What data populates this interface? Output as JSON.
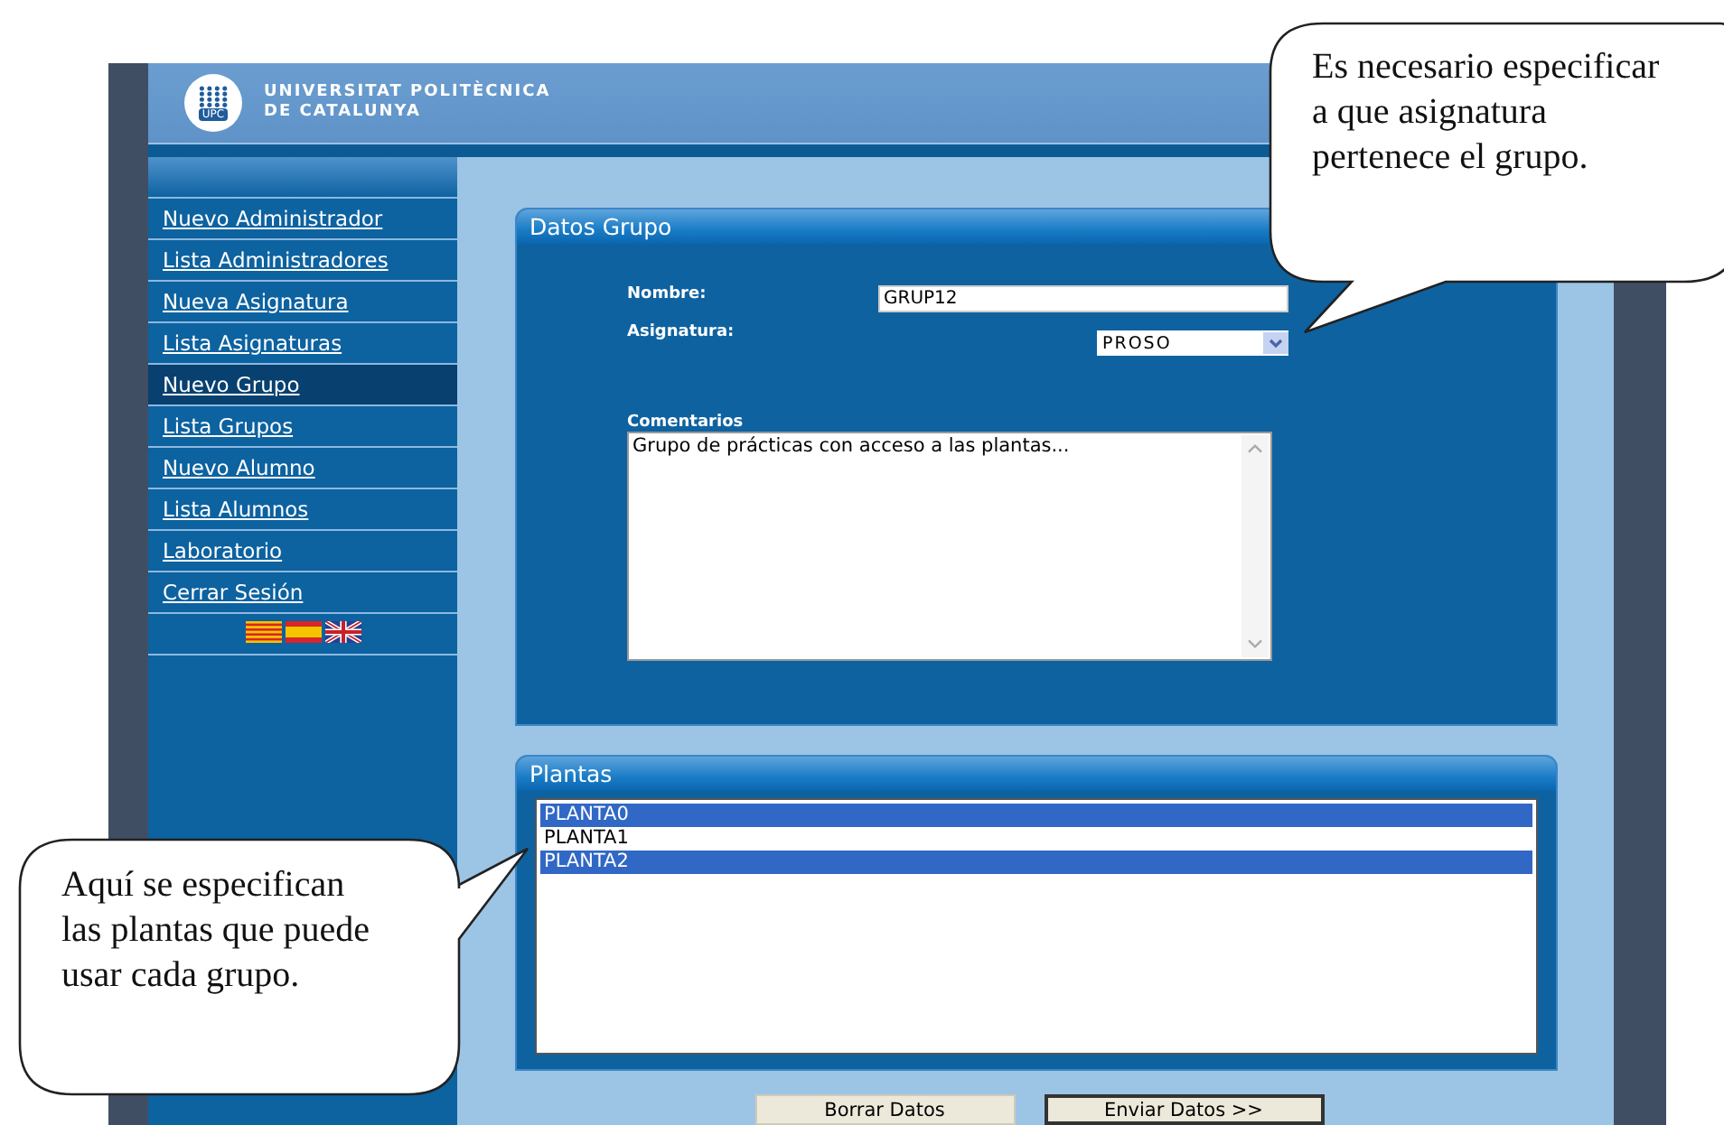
{
  "header": {
    "logo_badge": "UPC",
    "logo_lines": [
      "UNIVERSITAT POLITÈCNICA",
      "DE CATALUNYA"
    ]
  },
  "sidebar": {
    "items": [
      {
        "label": "Nuevo Administrador",
        "selected": false
      },
      {
        "label": "Lista Administradores",
        "selected": false
      },
      {
        "label": "Nueva Asignatura",
        "selected": false
      },
      {
        "label": "Lista Asignaturas",
        "selected": false
      },
      {
        "label": "Nuevo Grupo",
        "selected": true
      },
      {
        "label": "Lista Grupos",
        "selected": false
      },
      {
        "label": "Nuevo Alumno",
        "selected": false
      },
      {
        "label": "Lista Alumnos",
        "selected": false
      },
      {
        "label": "Laboratorio",
        "selected": false
      },
      {
        "label": "Cerrar Sesión",
        "selected": false
      }
    ]
  },
  "group_panel": {
    "title": "Datos Grupo",
    "name_label": "Nombre:",
    "name_value": "GRUP12",
    "subject_label": "Asignatura:",
    "subject_value": "PROSO",
    "comments_label": "Comentarios",
    "comments_value": "Grupo de prácticas con acceso a las plantas..."
  },
  "plants_panel": {
    "title": "Plantas",
    "items": [
      {
        "label": "PLANTA0",
        "selected": true
      },
      {
        "label": "PLANTA1",
        "selected": false
      },
      {
        "label": "PLANTA2",
        "selected": true
      }
    ]
  },
  "buttons": [
    {
      "label": "Borrar Datos",
      "kind": "reset"
    },
    {
      "label": "Enviar Datos >>",
      "kind": "submit"
    }
  ],
  "callouts": [
    {
      "text": "Es necesario especificar a que asignatura pertenece el grupo.",
      "kind": "top"
    },
    {
      "text": "Aquí se especifican las plantas que puede usar cada grupo.",
      "kind": "left"
    }
  ]
}
